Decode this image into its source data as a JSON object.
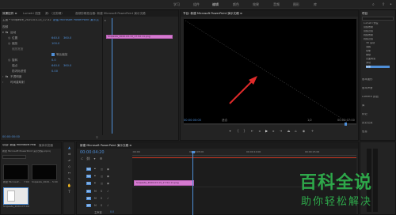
{
  "menu": {
    "items": [
      "学习",
      "组件",
      "编辑",
      "颜色",
      "效果",
      "音频",
      "图形",
      "库"
    ]
  },
  "effect_controls": {
    "tabs": [
      "效果控件 ≡",
      "Lumetri 范围",
      "源: （无剪辑）",
      "音频剪辑混合器: 新建 Microsoft PowerPoint 演示文稿"
    ],
    "master_label": "主要 * Snipaste_2020-03-13_17-52-11.png",
    "sequence_label": "新建 Microsoft PowerPoint 演示文稿 * Snipas...",
    "section_video": "视频",
    "fx_motion": "运动",
    "prop_position": "位置",
    "pos_x": "640.0",
    "pos_y": "360.0",
    "prop_scale": "缩放",
    "scale_val": "100.0",
    "prop_scale_width": "缩放宽度",
    "uniform_scale": "等比缩放",
    "prop_rotation": "旋转",
    "rotation_val": "0.0",
    "prop_anchor": "锚点",
    "anchor_x": "640.0",
    "anchor_y": "360.0",
    "prop_antiflicker": "防闪烁滤镜",
    "antiflicker_val": "0.00",
    "fx_opacity": "不透明度",
    "fx_timeremap": "时间重映射",
    "clip_label": "Snipaste_2020-03-13_17-52-11.png",
    "timecode": "00:00:00:00"
  },
  "program_monitor": {
    "tab": "节目: 新建 Microsoft PowerPoint 演示文稿 ≡",
    "timecode": "00:00:00:00",
    "fit": "适合",
    "ratio": "1/2",
    "duration": "00:00:07:00"
  },
  "right_panel": {
    "title": "项目",
    "items": [
      "Lumetri 预设",
      "音频效果",
      "音频过渡",
      "视频效果",
      "视频过渡",
      "3D 运动",
      "溶解",
      "划像",
      "擦除",
      "页面剥落",
      "滑动",
      "缩放"
    ],
    "sections": [
      "基本图形",
      "基本声音",
      "Lumetri 颜色",
      "库",
      "标记",
      "历史记录",
      "信息"
    ]
  },
  "project": {
    "tabs": [
      "项目: 新建 Microsoft PowerPoint 演示文稿 ≡",
      "媒体浏览器"
    ],
    "filename": "新建 Microsoft PowerPoint 演示文稿.prproj",
    "items": [
      "新建 Microsof...",
      "Snipaste_2020...",
      "Snipaste_2020-03..."
    ],
    "durations": [
      "7:00",
      "5:00",
      "5:00"
    ]
  },
  "timeline": {
    "tab": "新建 Microsoft PowerPoint 演示文稿 ≡",
    "timecode": "00:00:04:20",
    "ruler": [
      ":00:00",
      "00:00:05:00",
      "00:00:10:00",
      "00:00:15:00"
    ],
    "tracks_v": [
      "V3",
      "V2",
      "V1"
    ],
    "tracks_a": [
      "A1",
      "A2",
      "A3"
    ],
    "master": "主声道",
    "master_val": "0.0",
    "clip": "Snipaste_2020-03-13_17-52-11.png",
    "playhead_fraction": 0.27
  },
  "watermark": {
    "title": "百科全说",
    "subtitle": "助你轻松解决"
  },
  "colors": {
    "accent": "#4f8fd8",
    "clip": "#d57ad0",
    "arrow": "#e02a2a",
    "watermark": "#2ea84a"
  }
}
